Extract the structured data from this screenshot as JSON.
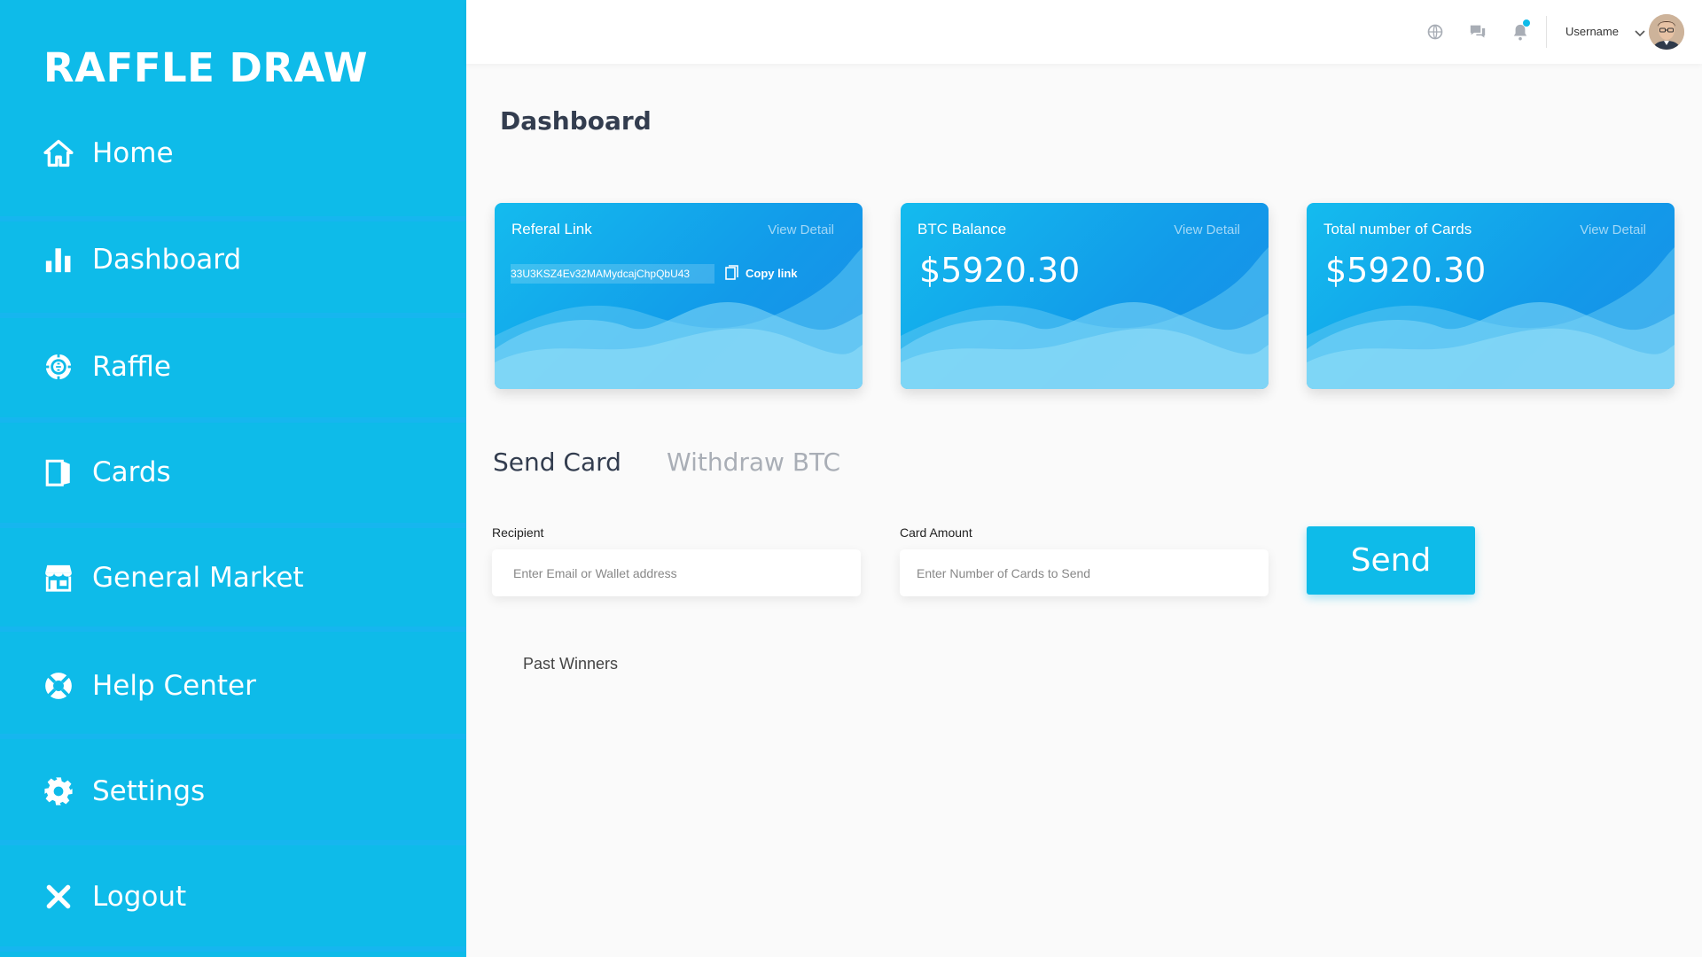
{
  "brand": "RAFFLE DRAW",
  "sidebar": {
    "items": [
      {
        "label": "Home",
        "icon": "home-icon"
      },
      {
        "label": "Dashboard",
        "icon": "bar-chart-icon"
      },
      {
        "label": "Raffle",
        "icon": "raffle-chip-icon"
      },
      {
        "label": "Cards",
        "icon": "card-icon"
      },
      {
        "label": "General Market",
        "icon": "store-icon"
      },
      {
        "label": "Help Center",
        "icon": "lifebuoy-icon"
      },
      {
        "label": "Settings",
        "icon": "gear-icon"
      },
      {
        "label": "Logout",
        "icon": "close-icon"
      }
    ]
  },
  "topbar": {
    "username": "Username",
    "icons": [
      "globe-icon",
      "chat-icon",
      "bell-icon",
      "chevron-down-icon"
    ]
  },
  "page_title": "Dashboard",
  "cards": [
    {
      "title": "Referal Link",
      "detail": "View Detail",
      "link": "33U3KSZ4Ev32MAMydcajChpQbU43",
      "copy_label": "Copy link"
    },
    {
      "title": "BTC Balance",
      "detail": "View Detail",
      "value": "$5920.30"
    },
    {
      "title": "Total number of Cards",
      "detail": "View Detail",
      "value": "$5920.30"
    }
  ],
  "tabs": [
    {
      "label": "Send Card",
      "active": true
    },
    {
      "label": "Withdraw BTC",
      "active": false
    }
  ],
  "form": {
    "recipient_label": "Recipient",
    "recipient_placeholder": "Enter Email or Wallet address",
    "amount_label": "Card Amount",
    "amount_placeholder": "Enter Number of Cards to Send",
    "send_label": "Send"
  },
  "past_winners": "Past Winners",
  "colors": {
    "sidebar": "#0ebbe9",
    "accent": "#0ebbe9",
    "card_gradient_start": "#14bbee",
    "card_gradient_end": "#1a8ee8",
    "notification_dot": "#0ebbe9"
  }
}
